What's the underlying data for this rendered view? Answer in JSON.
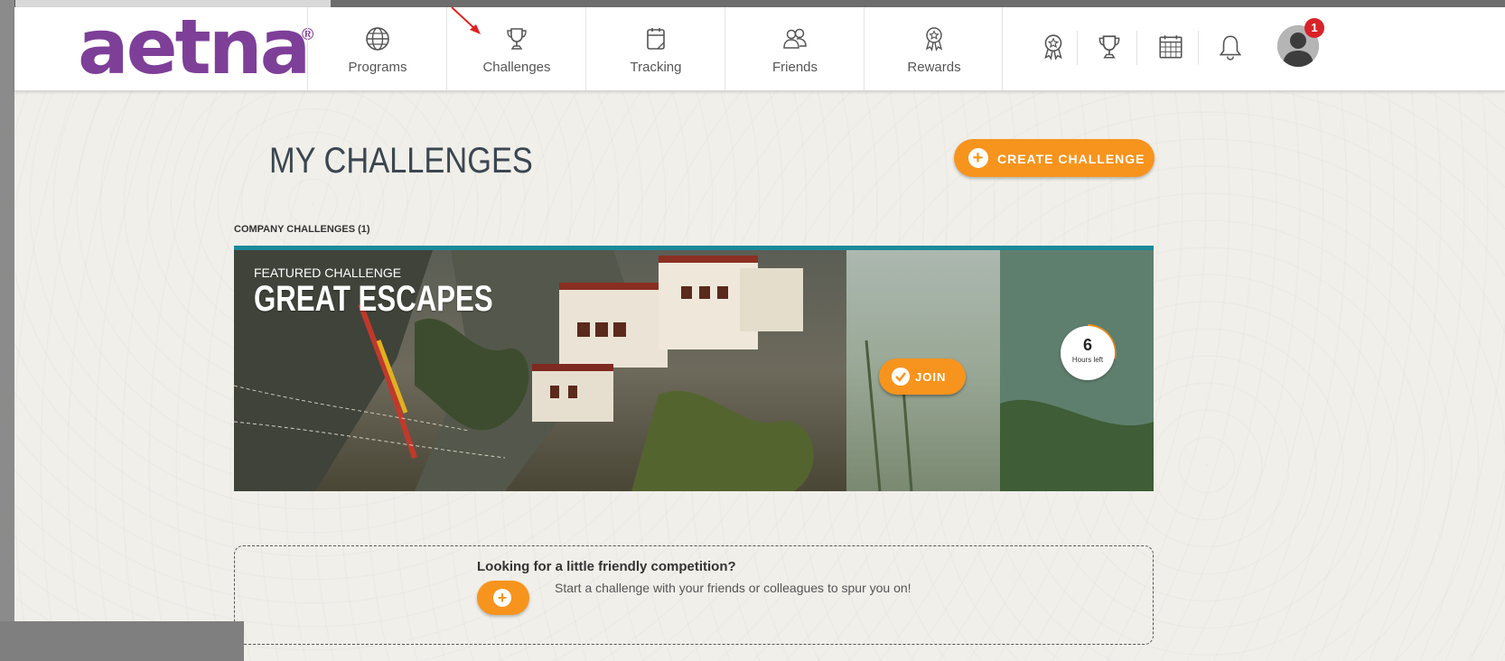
{
  "brand": {
    "logo_text": "aetna",
    "logo_mark": "®",
    "brand_color": "#7d3f98"
  },
  "nav": {
    "items": [
      {
        "label": "Programs",
        "icon": "globe-icon"
      },
      {
        "label": "Challenges",
        "icon": "trophy-icon"
      },
      {
        "label": "Tracking",
        "icon": "calendar-icon"
      },
      {
        "label": "Friends",
        "icon": "friends-icon"
      },
      {
        "label": "Rewards",
        "icon": "award-ribbon-icon"
      }
    ]
  },
  "utilities": {
    "icons": [
      "award-ribbon-icon",
      "trophy-icon",
      "calendar-grid-icon",
      "bell-icon"
    ],
    "notification_count": "1"
  },
  "page": {
    "title": "MY CHALLENGES",
    "create_label": "CREATE CHALLENGE",
    "section_label": "COMPANY CHALLENGES (1)"
  },
  "featured": {
    "kicker": "FEATURED CHALLENGE",
    "name": "GREAT ESCAPES",
    "join_label": "JOIN",
    "time_value": "6",
    "time_unit": "Hours left",
    "accent_color": "#1b8a9a"
  },
  "invite": {
    "title": "Looking for a little friendly competition?",
    "text": "Start a challenge with your friends or colleagues to spur you on!"
  },
  "colors": {
    "orange": "#f7941d",
    "badge_red": "#d8232a"
  }
}
